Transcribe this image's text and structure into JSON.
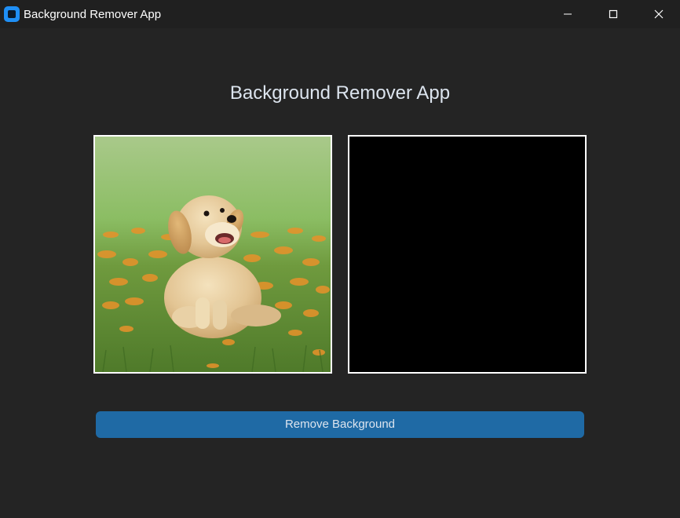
{
  "window": {
    "title": "Background Remover App",
    "icon": "app-logo-icon",
    "controls": [
      "minimize-icon",
      "maximize-icon",
      "close-icon"
    ]
  },
  "main": {
    "heading": "Background Remover App",
    "input_image": {
      "icon": "image-photo",
      "subject": "puppy"
    },
    "output_image": {
      "state": "empty"
    },
    "remove_button_label": "Remove Background"
  },
  "colors": {
    "window_bg": "#242424",
    "titlebar_bg": "#202020",
    "button_bg": "#1f6aa5",
    "button_text": "#dce4ee",
    "panel_border": "#ffffff",
    "output_bg": "#000000"
  }
}
